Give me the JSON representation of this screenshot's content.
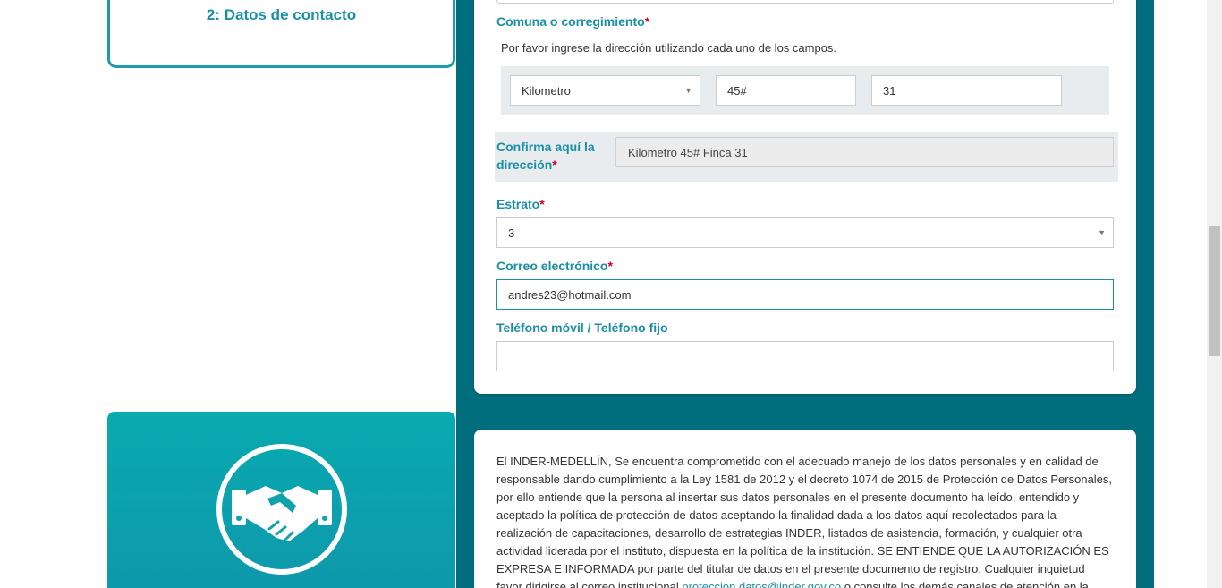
{
  "sidebar": {
    "step_label": "2: Datos de contacto",
    "card_icon": "handshake-icon"
  },
  "form": {
    "comuna_label": "Comuna o corregimiento",
    "required_mark": "*",
    "address_hint": "Por favor ingrese la dirección utilizando cada uno de los campos.",
    "address": {
      "type_value": "Kilometro",
      "number_value": "45#",
      "extra_value": "31"
    },
    "confirm_label": "Confirma aquí la dirección",
    "confirm_value": "Kilometro 45# Finca 31",
    "estrato_label": "Estrato",
    "estrato_value": "3",
    "email_label": "Correo electrónico",
    "email_value": "andres23@hotmail.com",
    "phone_label": "Teléfono móvil / Teléfono fijo",
    "phone_value": ""
  },
  "legal": {
    "text": "El INDER-MEDELLÍN, Se encuentra comprometido con el adecuado manejo de los datos personales y en calidad de responsable dando cumplimiento a la Ley 1581 de 2012 y el decreto 1074 de 2015 de Protección de Datos Personales, por ello entiende que la persona al insertar sus datos personales en el presente documento ha leído, entendido y aceptado la política de protección de datos aceptando la finalidad dada a los datos aquí recolectados para la realización de capacitaciones, desarrollo de estrategias INDER, listados de asistencia, formación, y cualquier otra actividad liderada por el instituto, dispuesta en la política de la institución. SE ENTIENDE QUE LA AUTORIZACIÓN ES EXPRESA E INFORMADA por parte del titular de datos en el presente documento de registro. Cualquier inquietud favor dirigirse al correo institucional ",
    "link": "proteccion.datos@inder.gov.co",
    "text_after": " o consulte los demás canales de atención en la política"
  },
  "colors": {
    "accent": "#1a8fa6",
    "teal_background": "#016e7e",
    "required": "#d0021b"
  }
}
